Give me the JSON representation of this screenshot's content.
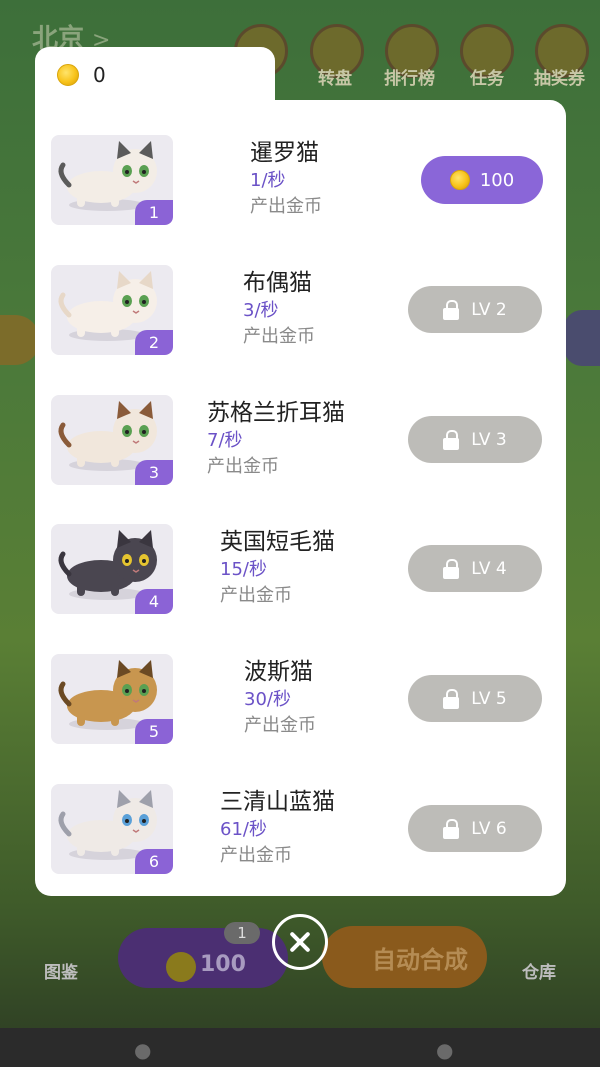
{
  "background": {
    "city": "北京",
    "city_chevron": ">",
    "top_buttons": [
      {
        "label": "转盘",
        "icon": "wheel-icon"
      },
      {
        "label": "排行榜",
        "icon": "trophy-icon"
      },
      {
        "label": "任务",
        "icon": "task-icon"
      },
      {
        "label": "抽奖券",
        "icon": "ticket-icon"
      }
    ],
    "left_bottom_label": "图鉴",
    "right_bottom_label": "仓库",
    "buy_pill_value": "100",
    "buy_pill_badge": "1",
    "auto_merge_label": "自动合成"
  },
  "coin_bar": {
    "value": "0",
    "icon": "gold-coin-icon"
  },
  "cats": [
    {
      "name": "暹罗猫",
      "rate": "1/秒",
      "produce": "产出金币",
      "level": "1",
      "state": "buy",
      "price": "100",
      "fur": "#f3ede6",
      "accent": "#5b5b5b"
    },
    {
      "name": "布偶猫",
      "rate": "3/秒",
      "produce": "产出金币",
      "level": "2",
      "state": "locked",
      "lock_label": "LV 2",
      "fur": "#f6efe8",
      "accent": "#e7d8c8"
    },
    {
      "name": "苏格兰折耳猫",
      "rate": "7/秒",
      "produce": "产出金币",
      "level": "3",
      "state": "locked",
      "lock_label": "LV 3",
      "fur": "#f1e7dc",
      "accent": "#8a5b3a"
    },
    {
      "name": "英国短毛猫",
      "rate": "15/秒",
      "produce": "产出金币",
      "level": "4",
      "state": "locked",
      "lock_label": "LV 4",
      "fur": "#4a4650",
      "accent": "#3a363f"
    },
    {
      "name": "波斯猫",
      "rate": "30/秒",
      "produce": "产出金币",
      "level": "5",
      "state": "locked",
      "lock_label": "LV 5",
      "fur": "#c8964f",
      "accent": "#6b4a24"
    },
    {
      "name": "三清山蓝猫",
      "rate": "61/秒",
      "produce": "产出金币",
      "level": "6",
      "state": "locked",
      "lock_label": "LV 6",
      "fur": "#efeae6",
      "accent": "#9ea0ab"
    }
  ],
  "colors": {
    "accent": "#8a66d8",
    "locked": "#bdbcb8",
    "rate_text": "#6b52c7"
  },
  "close_icon": "close-icon"
}
